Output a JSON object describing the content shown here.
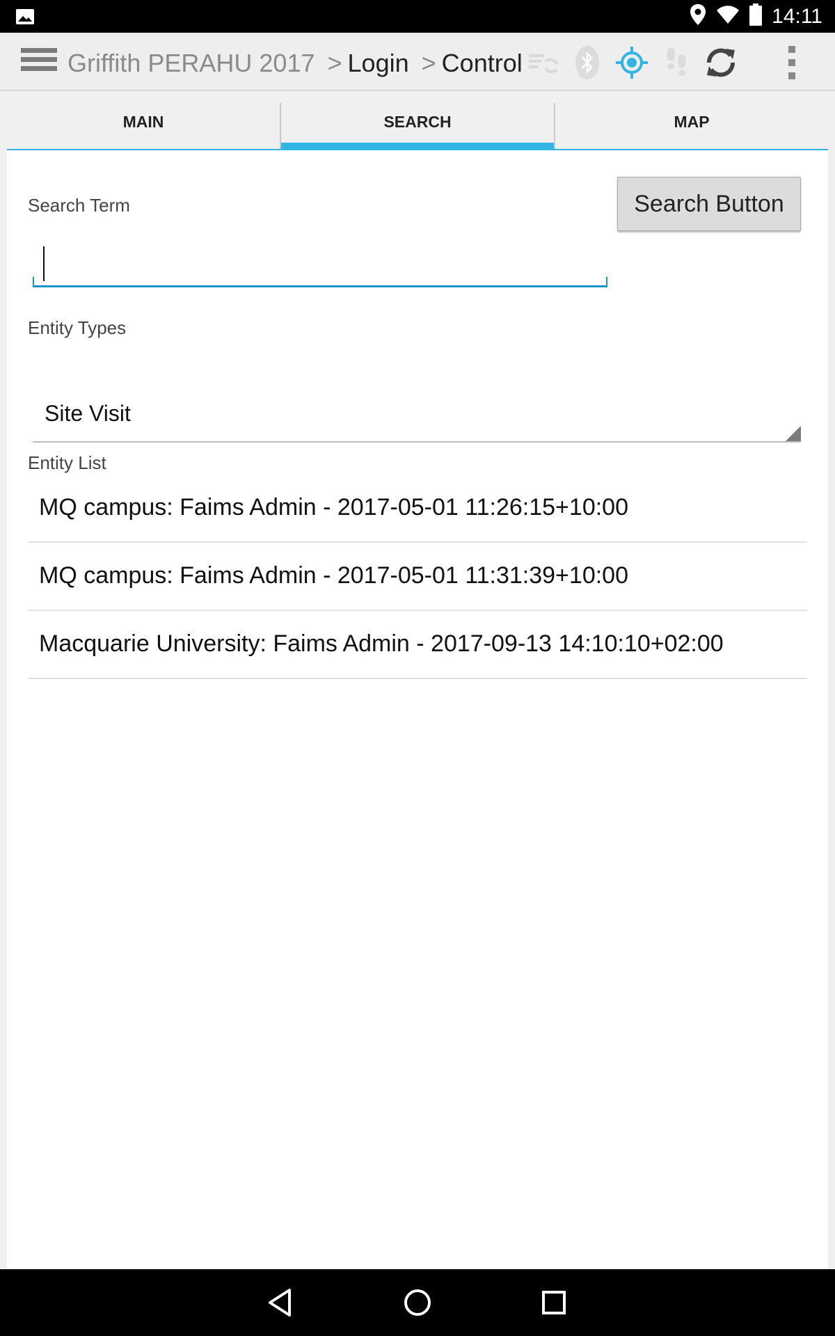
{
  "status_bar": {
    "time": "14:11",
    "icons": [
      "image-icon",
      "location-icon",
      "wifi-icon",
      "battery-icon"
    ]
  },
  "action_bar": {
    "menu_icon": "hamburger-menu-icon",
    "title_module": "Griffith PERAHU 2017",
    "title_sep1": ">",
    "title_page1": "Login",
    "title_sep2": ">",
    "title_page2": "Control",
    "icons": [
      "sync-status-icon",
      "bluetooth-icon",
      "gps-icon",
      "tracking-footsteps-icon",
      "refresh-icon",
      "overflow-menu-icon"
    ],
    "accent": "#32b4e5"
  },
  "tabs": [
    {
      "label": "MAIN",
      "active": false
    },
    {
      "label": "SEARCH",
      "active": true
    },
    {
      "label": "MAP",
      "active": false
    }
  ],
  "search": {
    "term_label": "Search Term",
    "button_label": "Search Button",
    "input_value": ""
  },
  "entity_types": {
    "label": "Entity Types",
    "selected": "Site Visit"
  },
  "entity_list": {
    "label": "Entity List",
    "items": [
      "MQ campus: Faims Admin - 2017-05-01 11:26:15+10:00",
      "MQ campus: Faims Admin - 2017-05-01 11:31:39+10:00",
      "Macquarie University: Faims Admin - 2017-09-13 14:10:10+02:00"
    ]
  },
  "nav_bar": {
    "icons": [
      "back-icon",
      "home-icon",
      "recents-icon"
    ]
  }
}
